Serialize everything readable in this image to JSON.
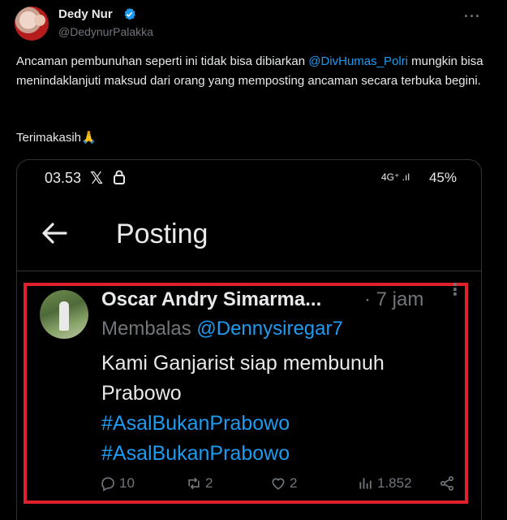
{
  "tweet": {
    "author_name": "Dedy Nur",
    "handle": "@DedynurPalakka",
    "body_before_mention": "Ancaman pembunuhan seperti ini tidak bisa dibiarkan ",
    "mention": "@DivHumas_Polri",
    "body_after_mention": " mungkin bisa menindaklanjuti maksud dari orang yang memposting ancaman secara terbuka begini.",
    "closing": "Terimakasih🙏",
    "more_label": "···"
  },
  "screenshot": {
    "status_bar": {
      "time": "03.53",
      "x_logo": "𝕏",
      "network": "4G⁺ .ıl",
      "battery": "45%"
    },
    "header": {
      "title": "Posting"
    },
    "reply": {
      "author": "Oscar Andry Simarma...",
      "time": "· 7 jam",
      "replying_to_label": "Membalas ",
      "replying_to_handle": "@Dennysiregar7",
      "text_line1": "Kami Ganjarist siap membunuh",
      "text_line2": "Prabowo",
      "hashtag1": "#AsalBukanPrabowo",
      "hashtag2": "#AsalBukanPrabowo",
      "more_label": "⋮",
      "actions": {
        "replies": "10",
        "reposts": "2",
        "likes": "2",
        "views": "1.852"
      }
    }
  },
  "colors": {
    "accent": "#1d9bf0",
    "highlight_box": "#e0202a",
    "muted": "#71767b"
  }
}
